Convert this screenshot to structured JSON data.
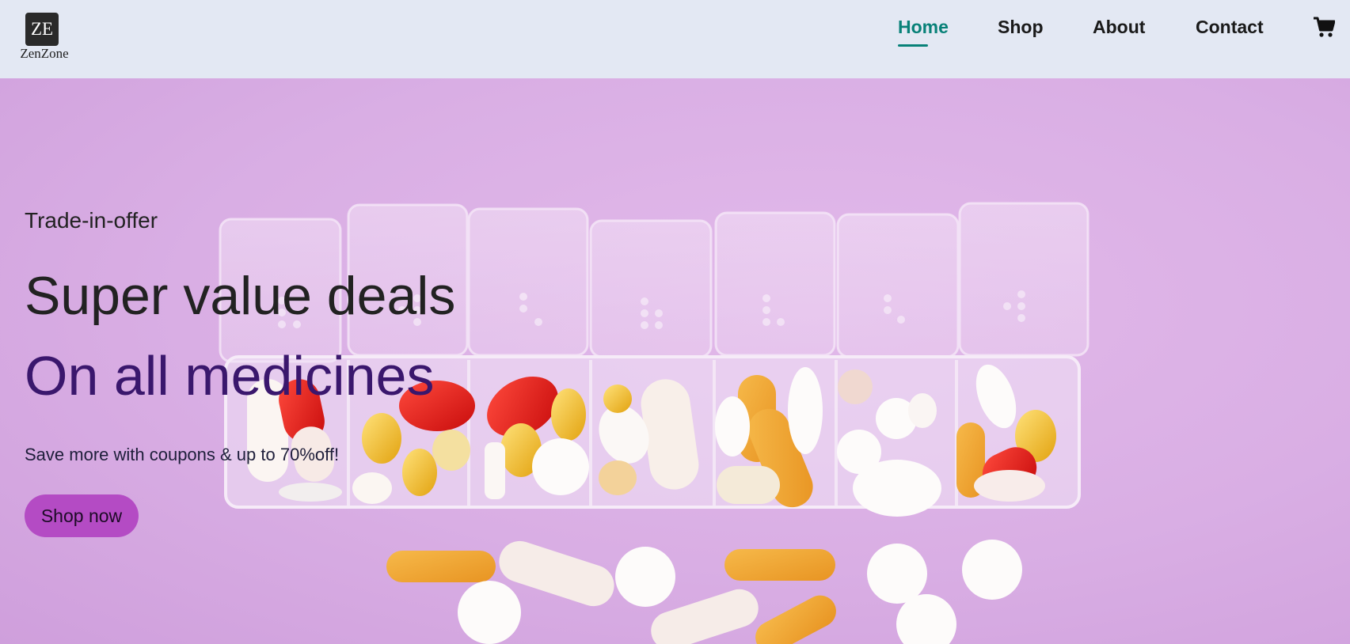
{
  "header": {
    "logo_mark": "ZE",
    "logo_name": "ZenZone",
    "nav": [
      {
        "label": "Home",
        "active": true
      },
      {
        "label": "Shop",
        "active": false
      },
      {
        "label": "About",
        "active": false
      },
      {
        "label": "Contact",
        "active": false
      }
    ],
    "cart_icon": "shopping-cart-icon"
  },
  "hero": {
    "tagline": "Trade-in-offer",
    "headline": "Super value deals",
    "subheadline": "On all medicines",
    "description": "Save more with coupons & up to 70%off!",
    "button_label": "Shop now",
    "background_image": "pill-organizer-with-capsules-on-purple"
  },
  "colors": {
    "accent": "#088178",
    "header_bg": "#e3e8f3",
    "hero_bg": "#d9aee4",
    "headline_purple": "#3a176d",
    "button_bg": "#b44bc4"
  }
}
